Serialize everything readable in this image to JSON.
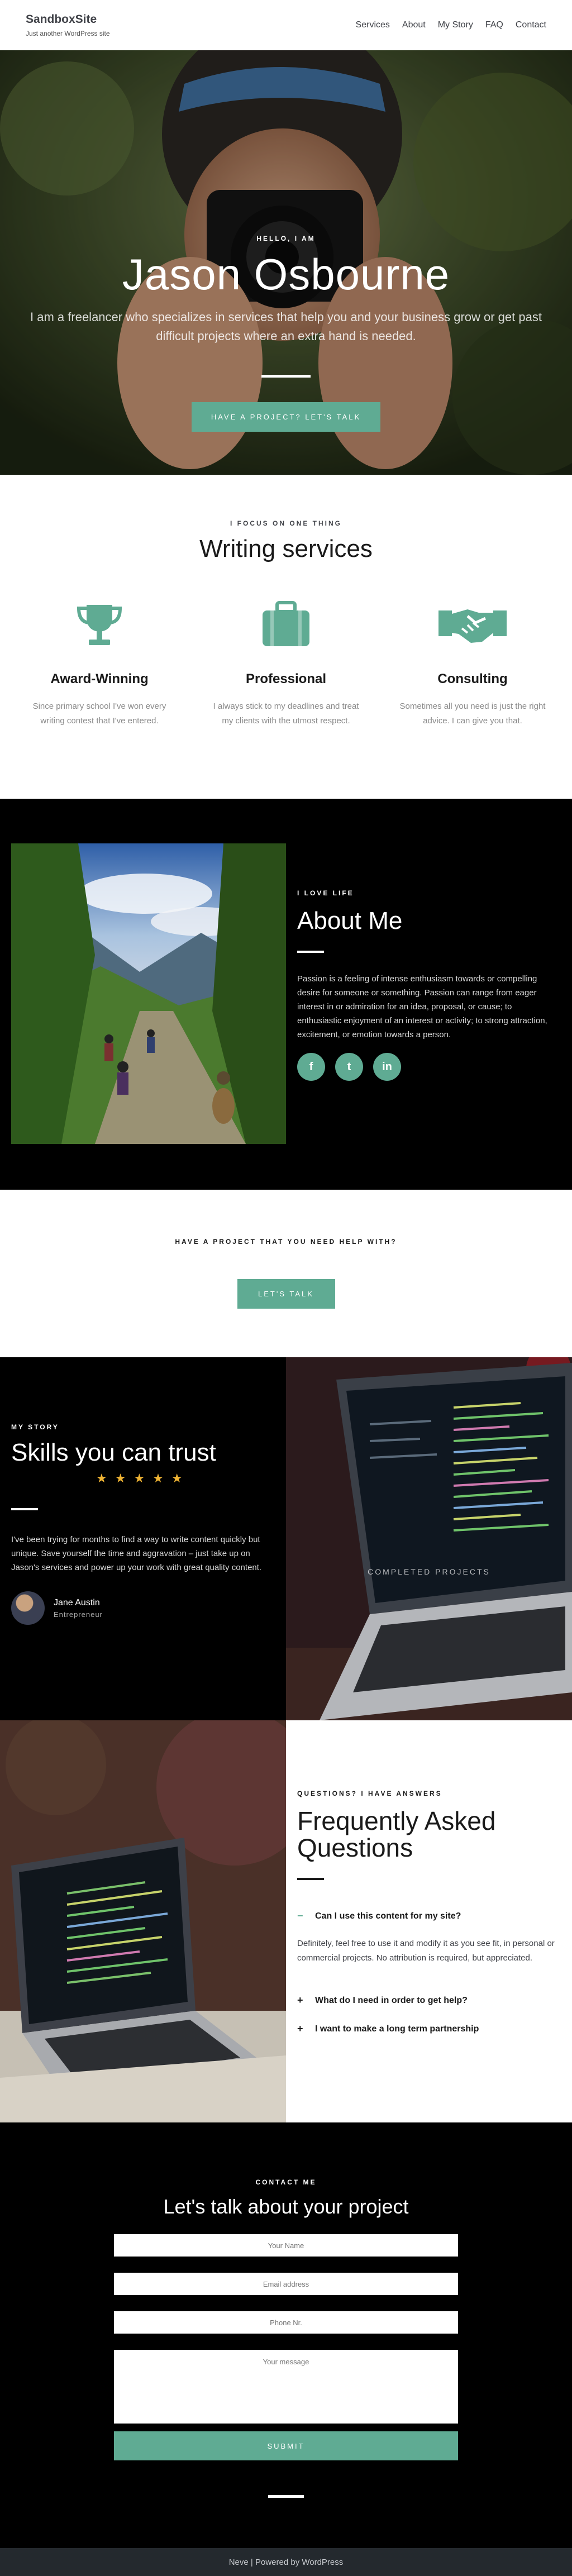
{
  "header": {
    "site_title": "SandboxSite",
    "tagline": "Just another WordPress site",
    "nav": [
      "Services",
      "About",
      "My Story",
      "FAQ",
      "Contact"
    ]
  },
  "hero": {
    "eyebrow": "HELLO, I AM",
    "title": "Jason Osbourne",
    "subtitle": "I am a freelancer who specializes in services that help you and your business grow or get past difficult projects where an extra hand is needed.",
    "button": "HAVE A PROJECT? LET'S TALK"
  },
  "services": {
    "eyebrow": "I FOCUS ON ONE THING",
    "title": "Writing services",
    "items": [
      {
        "icon": "trophy-icon",
        "title": "Award-Winning",
        "text": "Since primary school I've won every writing contest that I've entered."
      },
      {
        "icon": "briefcase-icon",
        "title": "Professional",
        "text": "I always stick to my deadlines and treat my clients with the utmost respect."
      },
      {
        "icon": "handshake-icon",
        "title": "Consulting",
        "text": "Sometimes all you need is just the right advice. I can give you that."
      }
    ]
  },
  "about": {
    "eyebrow": "I LOVE LIFE",
    "title": "About Me",
    "text": "Passion is a feeling of intense enthusiasm towards or compelling desire for someone or something. Passion can range from eager interest in or admiration for an idea, proposal, or cause; to enthusiastic enjoyment of an interest or activity; to strong attraction, excitement, or emotion towards a person.",
    "socials": [
      {
        "icon": "facebook-icon",
        "glyph": "f"
      },
      {
        "icon": "twitter-icon",
        "glyph": "t"
      },
      {
        "icon": "linkedin-icon",
        "glyph": "in"
      }
    ]
  },
  "cta": {
    "title": "HAVE A PROJECT THAT YOU NEED HELP WITH?",
    "button": "LET'S TALK"
  },
  "story": {
    "eyebrow": "MY STORY",
    "title": "Skills you can trust",
    "stars": "★★★★★",
    "text": "I've been trying for months to find a way to write content quickly but unique. Save yourself the time and aggravation – just take up on Jason's services and power up your work with great quality content.",
    "author_name": "Jane Austin",
    "author_role": "Entrepreneur",
    "image_caption": "COMPLETED PROJECTS"
  },
  "faq": {
    "eyebrow": "QUESTIONS? I HAVE ANSWERS",
    "title_line1": "Frequently Asked",
    "title_line2": "Questions",
    "open_question": "Can I use this content for my site?",
    "open_answer": "Definitely, feel free to use it and modify it as you see fit, in personal or commercial projects. No attribution is required, but appreciated.",
    "question2": "What do I need in order to get help?",
    "question3": "I want to make a long term partnership",
    "open_sign": "−",
    "closed_sign": "+"
  },
  "contact": {
    "eyebrow": "CONTACT ME",
    "title": "Let's talk about your project",
    "name_placeholder": "Your Name",
    "email_placeholder": "Email address",
    "phone_placeholder": "Phone Nr.",
    "message_placeholder": "Your message",
    "submit": "SUBMIT"
  },
  "footer": {
    "theme": "Neve",
    "separator": " | ",
    "powered": "Powered by WordPress"
  },
  "colors": {
    "accent": "#5fab93",
    "dark": "#000000",
    "footer": "#24292e",
    "star": "#f0b434"
  }
}
